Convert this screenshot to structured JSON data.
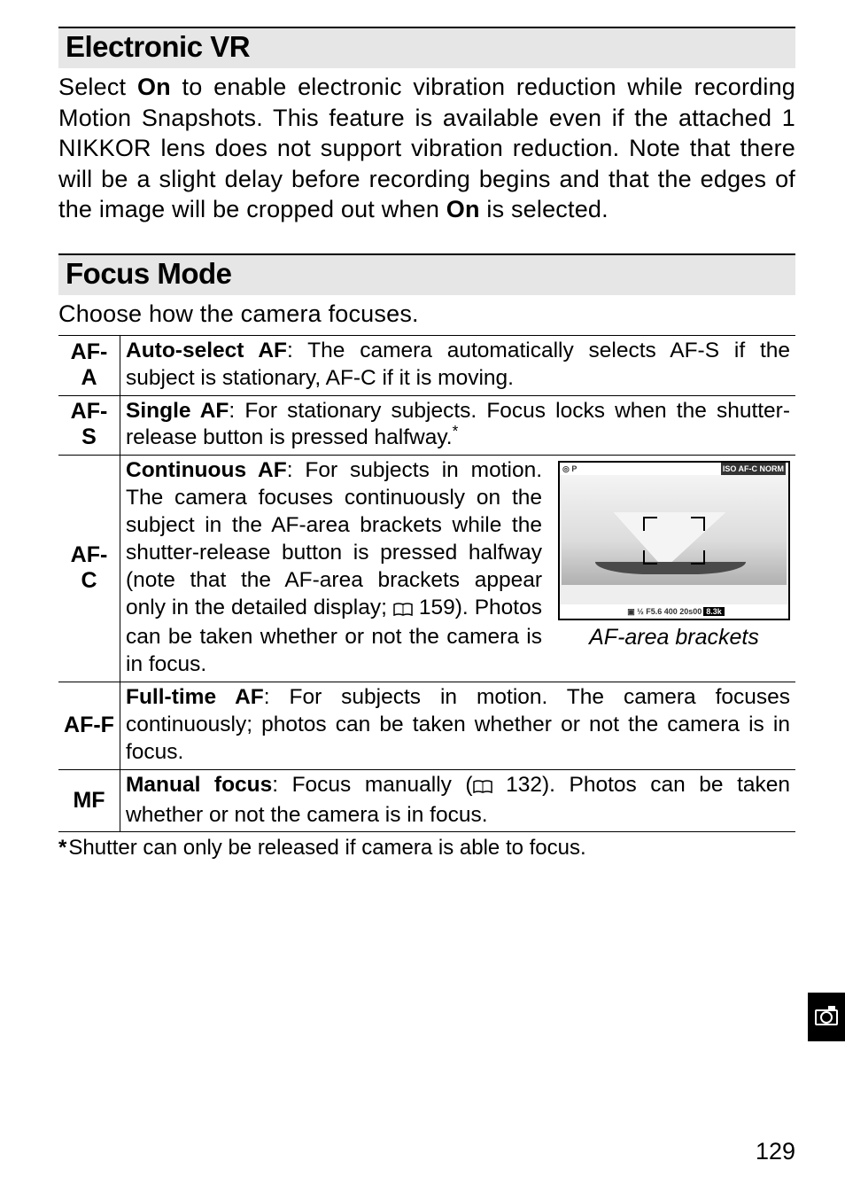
{
  "sections": {
    "evr": {
      "title": "Electronic VR",
      "body_pre": "Select ",
      "body_on1": "On",
      "body_mid": " to enable electronic vibration reduction while recording Motion Snapshots. This feature is available even if the attached 1 NIKKOR lens does not support vibration reduction. Note that there will be a slight delay before recording begins and that the edges of the image will be cropped out when ",
      "body_on2": "On",
      "body_post": " is selected."
    },
    "focus": {
      "title": "Focus Mode",
      "intro": "Choose how the camera focuses."
    }
  },
  "modes": {
    "afa": {
      "key": "AF-A",
      "label": "Auto-select AF",
      "text": ": The camera automatically selects AF-S if the subject is stationary, AF-C if it is moving."
    },
    "afs": {
      "key": "AF-S",
      "label": "Single AF",
      "text": ": For stationary subjects. Focus locks when the shutter-release button is pressed halfway.",
      "star": "*"
    },
    "afc": {
      "key": "AF-C",
      "label": "Continuous AF",
      "text_pre": ": For subjects in motion. The camera focuses continuously on the subject in the AF-area brackets while the shutter-release button is pressed halfway (note that the AF-area brackets appear only in the detailed display; ",
      "ref": "159",
      "text_post": "). Photos can be taken whether or not the camera is in focus.",
      "figure_top_left": "◎ P",
      "figure_top_right": "ISO AF-C NORM",
      "figure_bot": "F5.6 400 20s00",
      "figure_bot_black": "8.3k",
      "caption": "AF-area brackets"
    },
    "aff": {
      "key": "AF-F",
      "label": "Full-time AF",
      "text": ": For subjects in motion. The camera focuses continuously; photos can be taken whether or not the camera is in focus."
    },
    "mf": {
      "key": "MF",
      "label": "Manual focus",
      "text_pre": ": Focus manually (",
      "ref": "132",
      "text_post": "). Photos can be taken whether or not the camera is in focus."
    }
  },
  "footnote": {
    "star": "*",
    "text": "Shutter can only be released if camera is able to focus."
  },
  "page_number": "129",
  "icons": {
    "book": "📖"
  }
}
